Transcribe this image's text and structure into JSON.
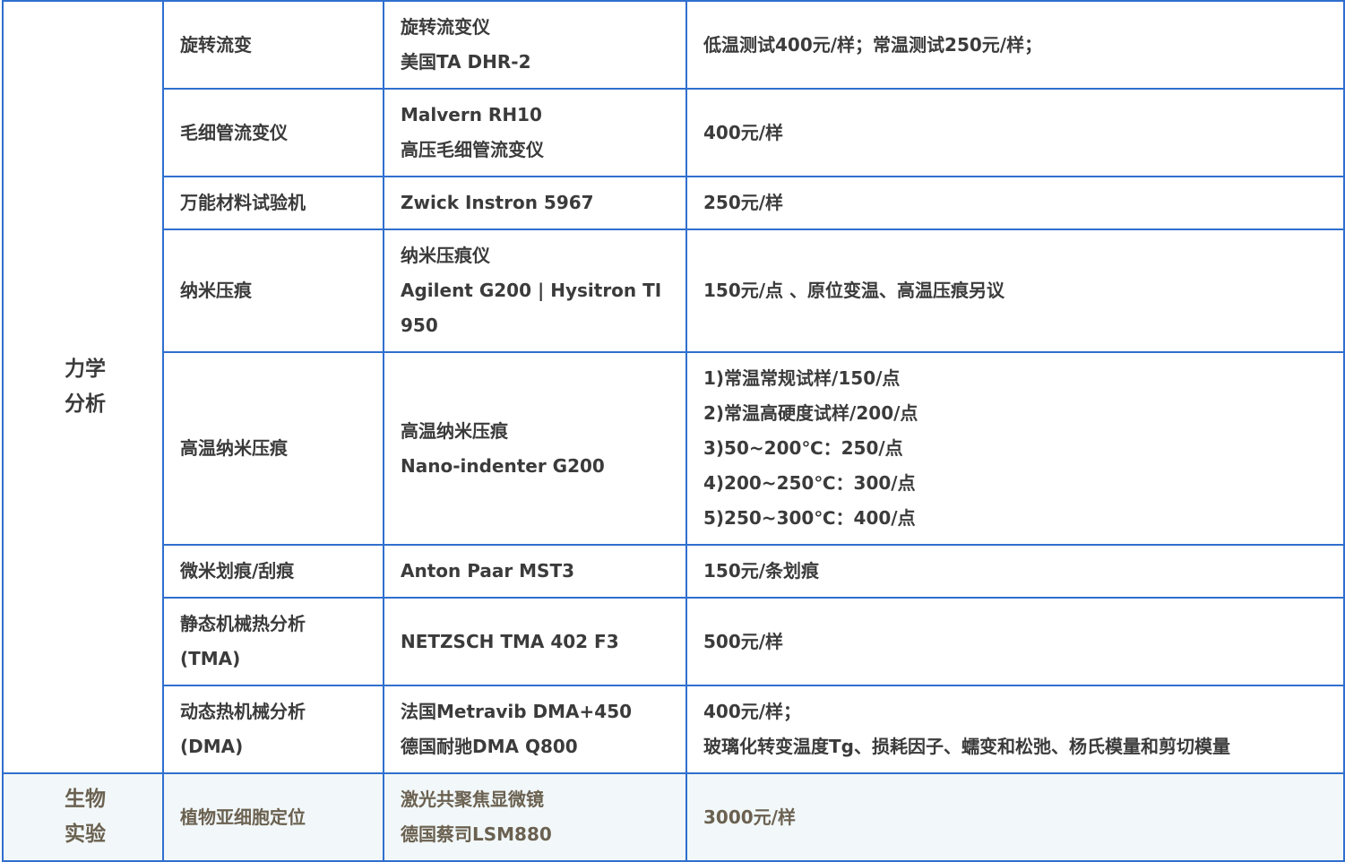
{
  "table": {
    "sections": [
      {
        "category": [
          "力学",
          "分析"
        ],
        "rows": [
          {
            "item": [
              "旋转流变"
            ],
            "instrument": [
              "旋转流变仪",
              "美国TA DHR-2"
            ],
            "price": [
              "低温测试400元/样；常温测试250元/样；"
            ]
          },
          {
            "item": [
              "毛细管流变仪"
            ],
            "instrument": [
              "Malvern RH10",
              "高压毛细管流变仪"
            ],
            "price": [
              "400元/样"
            ]
          },
          {
            "item": [
              "万能材料试验机"
            ],
            "instrument": [
              "Zwick Instron 5967"
            ],
            "price": [
              "250元/样"
            ]
          },
          {
            "item": [
              "纳米压痕"
            ],
            "instrument": [
              "纳米压痕仪",
              "Agilent G200 | Hysitron TI",
              "950"
            ],
            "price": [
              "150元/点 、原位变温、高温压痕另议"
            ]
          },
          {
            "item": [
              "高温纳米压痕"
            ],
            "instrument": [
              "高温纳米压痕",
              "Nano-indenter G200"
            ],
            "price": [
              "1)常温常规试样/150/点",
              "2)常温高硬度试样/200/点",
              "3)50~200℃：250/点",
              "4)200~250℃：300/点",
              "5)250~300℃：400/点"
            ]
          },
          {
            "item": [
              "微米划痕/刮痕"
            ],
            "instrument": [
              "Anton Paar MST3"
            ],
            "price": [
              "150元/条划痕"
            ]
          },
          {
            "item": [
              "静态机械热分析",
              "(TMA)"
            ],
            "instrument": [
              "NETZSCH TMA 402 F3"
            ],
            "price": [
              "500元/样"
            ]
          },
          {
            "item": [
              "动态热机械分析",
              "(DMA)"
            ],
            "instrument": [
              "法国Metravib DMA+450",
              "德国耐驰DMA Q800"
            ],
            "price": [
              "400元/样；",
              "玻璃化转变温度Tg、损耗因子、蠕变和松弛、杨氏模量和剪切模量"
            ]
          }
        ]
      },
      {
        "category": [
          "生物",
          "实验"
        ],
        "rows": [
          {
            "item": [
              "植物亚细胞定位"
            ],
            "instrument": [
              "激光共聚焦显微镜",
              "德国蔡司LSM880"
            ],
            "price": [
              "3000元/样"
            ]
          }
        ]
      }
    ]
  }
}
